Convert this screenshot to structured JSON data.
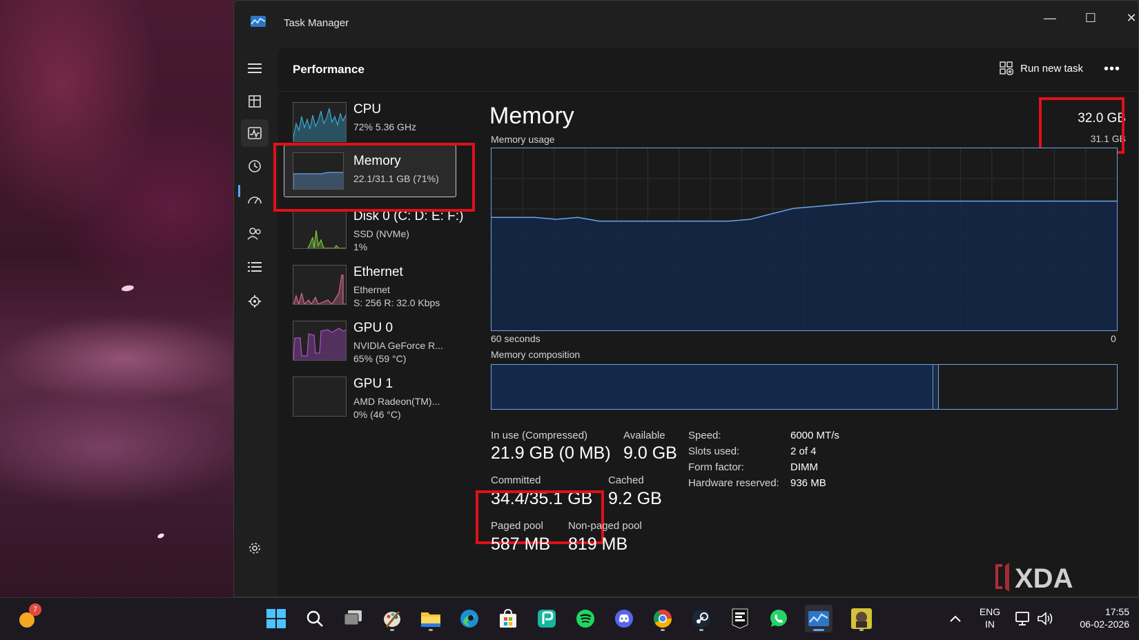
{
  "window": {
    "title": "Task Manager",
    "controls": {
      "minimize": "—",
      "maximize": "☐",
      "close": "✕"
    }
  },
  "header": {
    "page_title": "Performance",
    "run_task_label": "Run new task",
    "more_label": "•••"
  },
  "sidebar": {
    "items": [
      {
        "name": "menu",
        "icon": "hamburger-icon"
      },
      {
        "name": "processes",
        "icon": "processes-icon"
      },
      {
        "name": "performance",
        "icon": "performance-icon",
        "active": true
      },
      {
        "name": "app-history",
        "icon": "history-icon"
      },
      {
        "name": "startup-apps",
        "icon": "startup-icon"
      },
      {
        "name": "users",
        "icon": "users-icon"
      },
      {
        "name": "details",
        "icon": "details-icon"
      },
      {
        "name": "services",
        "icon": "services-icon"
      },
      {
        "name": "settings",
        "icon": "gear-icon"
      }
    ]
  },
  "devices": [
    {
      "name": "CPU",
      "sub1": "72% 5.36 GHz",
      "sub2": "",
      "sub3": "",
      "color": "#3aa9d8"
    },
    {
      "name": "Memory",
      "sub1": "22.1/31.1 GB (71%)",
      "sub2": "",
      "sub3": "",
      "color": "#6aa7e8",
      "selected": true
    },
    {
      "name": "Disk 0 (C: D: E: F:)",
      "sub1": "SSD (NVMe)",
      "sub2": "1%",
      "sub3": "",
      "color": "#7dc93c"
    },
    {
      "name": "Ethernet",
      "sub1": "Ethernet",
      "sub2": "S: 256 R: 32.0 Kbps",
      "sub3": "",
      "color": "#d56b8a"
    },
    {
      "name": "GPU 0",
      "sub1": "NVIDIA GeForce R...",
      "sub2": "65% (59 °C)",
      "sub3": "",
      "color": "#b04ecf"
    },
    {
      "name": "GPU 1",
      "sub1": "AMD Radeon(TM)...",
      "sub2": "0% (46 °C)",
      "sub3": "",
      "color": "#888888"
    }
  ],
  "memory": {
    "title": "Memory",
    "total": "32.0 GB",
    "usable": "31.1 GB",
    "usage_label": "Memory usage",
    "time_left": "60 seconds",
    "time_right": "0",
    "composition_label": "Memory composition",
    "usage_history_fraction": [
      0.62,
      0.62,
      0.62,
      0.61,
      0.62,
      0.6,
      0.6,
      0.6,
      0.6,
      0.6,
      0.6,
      0.6,
      0.61,
      0.64,
      0.67,
      0.68,
      0.69,
      0.7,
      0.71,
      0.71,
      0.71,
      0.71,
      0.71,
      0.71,
      0.71,
      0.71,
      0.71,
      0.71,
      0.71,
      0.71
    ]
  },
  "stats": {
    "in_use_label": "In use (Compressed)",
    "in_use_value": "21.9 GB (0 MB)",
    "available_label": "Available",
    "available_value": "9.0 GB",
    "committed_label": "Committed",
    "committed_value": "34.4/35.1 GB",
    "cached_label": "Cached",
    "cached_value": "9.2 GB",
    "paged_label": "Paged pool",
    "paged_value": "587 MB",
    "nonpaged_label": "Non-paged pool",
    "nonpaged_value": "819 MB"
  },
  "specs": [
    {
      "key": "Speed:",
      "value": "6000 MT/s"
    },
    {
      "key": "Slots used:",
      "value": "2 of 4"
    },
    {
      "key": "Form factor:",
      "value": "DIMM"
    },
    {
      "key": "Hardware reserved:",
      "value": "936 MB"
    }
  ],
  "taskbar": {
    "notification_count": "7",
    "lang_top": "ENG",
    "lang_bottom": "IN",
    "time": "17:55",
    "date": "06-02-2026"
  },
  "watermark": "XDA",
  "colors": {
    "accent_blue": "#60a5ff",
    "memory_line": "#6aa7e8",
    "memory_fill": "#142849",
    "highlight_red": "#e0101a"
  }
}
